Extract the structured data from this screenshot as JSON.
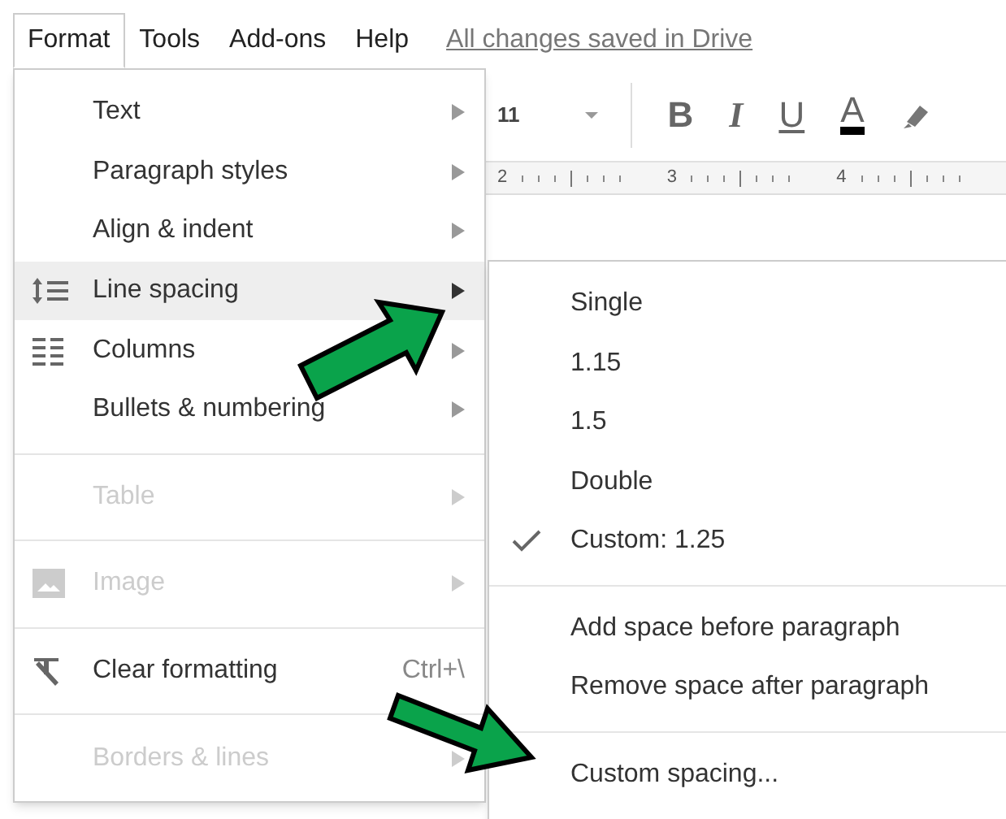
{
  "menubar": {
    "items": [
      {
        "label": "Format",
        "selected": true
      },
      {
        "label": "Tools",
        "selected": false
      },
      {
        "label": "Add-ons",
        "selected": false
      },
      {
        "label": "Help",
        "selected": false
      }
    ],
    "save_status": "All changes saved in Drive"
  },
  "toolbar": {
    "font_size": "11",
    "buttons": [
      "B",
      "I",
      "U",
      "A"
    ]
  },
  "ruler": {
    "labels": [
      "2",
      "3",
      "4"
    ]
  },
  "format_menu": {
    "sections": [
      [
        {
          "label": "Text",
          "disabled": false,
          "selected": false
        },
        {
          "label": "Paragraph styles",
          "disabled": false,
          "selected": false
        },
        {
          "label": "Align & indent",
          "disabled": false,
          "selected": false
        },
        {
          "label": "Line spacing",
          "disabled": false,
          "selected": true,
          "kind": "line-spacing"
        },
        {
          "label": "Columns",
          "disabled": false,
          "selected": false,
          "kind": "columns"
        },
        {
          "label": "Bullets & numbering",
          "disabled": false,
          "selected": false
        }
      ],
      [
        {
          "label": "Table",
          "disabled": true,
          "selected": false
        }
      ],
      [
        {
          "label": "Image",
          "disabled": true,
          "selected": false,
          "kind": "image"
        }
      ],
      [
        {
          "label": "Clear formatting",
          "disabled": false,
          "selected": false,
          "kind": "clear-format",
          "shortcut": "Ctrl+\\"
        }
      ],
      [
        {
          "label": "Borders & lines",
          "disabled": true,
          "selected": false
        }
      ]
    ]
  },
  "line_spacing_menu": {
    "sections": [
      [
        {
          "label": "Single",
          "checked": false
        },
        {
          "label": "1.15",
          "checked": false
        },
        {
          "label": "1.5",
          "checked": false
        },
        {
          "label": "Double",
          "checked": false
        },
        {
          "label": "Custom: 1.25",
          "checked": true
        }
      ],
      [
        {
          "label": "Add space before paragraph",
          "checked": false
        },
        {
          "label": "Remove space after paragraph",
          "checked": false
        }
      ],
      [
        {
          "label": "Custom spacing...",
          "checked": false
        }
      ]
    ]
  }
}
